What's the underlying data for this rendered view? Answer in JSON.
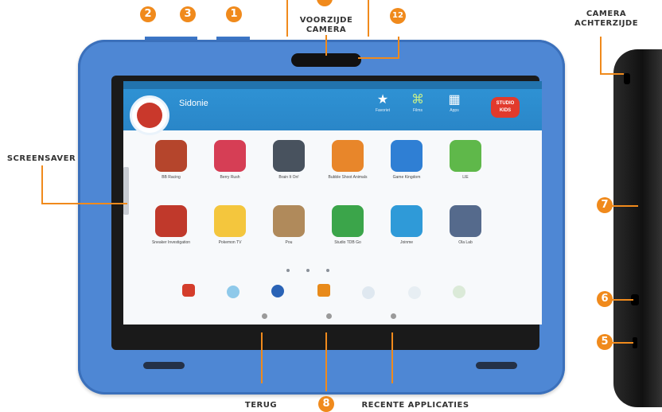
{
  "labels": {
    "front_camera_l1": "VOORZIJDE",
    "front_camera_l2": "CAMERA",
    "rear_camera_l1": "CAMERA",
    "rear_camera_l2": "ACHTERZIJDE",
    "screensaver": "SCREENSAVER",
    "back": "TERUG",
    "recent_apps": "RECENTE APPLICATIES"
  },
  "numbers": {
    "n2": "2",
    "n3": "3",
    "n1": "1",
    "n12": "12",
    "n7": "7",
    "n6": "6",
    "n5": "5",
    "n8": "8"
  },
  "screen": {
    "profile_name": "Sidonie",
    "nav": [
      {
        "label": "Favoriet",
        "icon": "star-icon"
      },
      {
        "label": "Films",
        "icon": "film-icon"
      },
      {
        "label": "Apps",
        "icon": "grid-icon"
      }
    ],
    "studio_badge_l1": "STUDIO",
    "studio_badge_l2": "KIDS",
    "apps_row1": [
      {
        "label": "BB Racing",
        "color": "#b5452c"
      },
      {
        "label": "Berry Rush",
        "color": "#d63e55"
      },
      {
        "label": "Brain It On!",
        "color": "#48525e"
      },
      {
        "label": "Bubble Shoot Animals",
        "color": "#e8862a"
      },
      {
        "label": "Game Kingdom",
        "color": "#2f7fd4"
      },
      {
        "label": "LIE",
        "color": "#5fb84a"
      }
    ],
    "apps_row2": [
      {
        "label": "Sneaker Investigation",
        "color": "#c0392b"
      },
      {
        "label": "Pokemon TV",
        "color": "#f4c63d"
      },
      {
        "label": "Pou",
        "color": "#b08a5b"
      },
      {
        "label": "Studio TDB Go",
        "color": "#3ba54a"
      },
      {
        "label": "Joinme",
        "color": "#2f9ad8"
      },
      {
        "label": "Ola Lab",
        "color": "#556a8c"
      }
    ]
  },
  "colors": {
    "accent": "#f08a1c",
    "tablet_blue": "#4e87d4",
    "bezel": "#1a1a1a"
  }
}
